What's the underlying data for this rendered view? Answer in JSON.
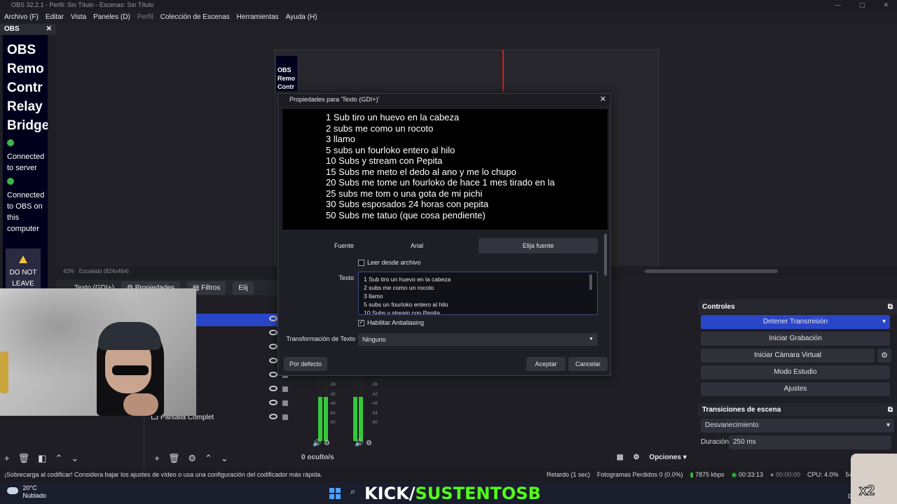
{
  "window": {
    "title": "OBS 32.2.1 - Perfil: Sin Título - Escenas: Sin Título"
  },
  "menu": [
    {
      "label": "Archivo (F)",
      "dim": false
    },
    {
      "label": "Editar",
      "dim": false
    },
    {
      "label": "Vista",
      "dim": false
    },
    {
      "label": "Paneles (D)",
      "dim": false
    },
    {
      "label": "Perfil",
      "dim": true
    },
    {
      "label": "Colección de Escenas",
      "dim": false
    },
    {
      "label": "Herramientas",
      "dim": false
    },
    {
      "label": "Ayuda (H)",
      "dim": false
    }
  ],
  "plugin_dock": {
    "title": "OBS",
    "heading_lines": [
      "OBS",
      "Remo",
      "Contr",
      "Relay",
      "Bridge"
    ],
    "status1": "Connected to server",
    "status2": "Connected to OBS on this computer",
    "warning": "DO NOT LEAVE"
  },
  "mini_obs": "OBS Remo Contr",
  "zoom": {
    "level": "42%",
    "scale": "Escalado (824x464)"
  },
  "source_toolbar": {
    "source_name": "Texto (GDI+)",
    "properties": "Propiedades",
    "filters": "Filtros",
    "more": "Elij"
  },
  "dialog": {
    "title": "Propiedades para 'Texto (GDI+)'",
    "preview_text": "1 Sub tiro un huevo en la cabeza\n2 subs me como un rocoto\n3 llamo\n5 subs un fourloko entero al hilo\n10 Subs y stream con Pepita\n15 Subs me meto el dedo al ano y me lo chupo\n20 Subs me tome un fourloko de hace 1 mes tirado en la\n25 subs me tom o una gota de mi pichi\n30 Subs esposados 24 horas con pepita\n50 Subs me tatuo (que cosa pendiente)",
    "font_label": "Fuente",
    "font_value": "Arial",
    "font_button": "Elija fuente",
    "read_from_file": "Leer desde archivo",
    "text_label": "Texto",
    "text_value": "1 Sub tiro un huevo en la cabeza\n2 subs me como un rocoto\n3 llamo\n5 subs un fourloko entero al hilo\n10 Subs y stream con Pepita",
    "antialias": "Habilitar Antialiasing",
    "transform_label": "Transformación de Texto",
    "transform_value": "Ninguno",
    "defaults_button": "Por defecto",
    "accept_button": "Aceptar",
    "cancel_button": "Cancelar"
  },
  "sources": {
    "bottom_label": "Pantalla Complet"
  },
  "mixer": {
    "status": "0 oculto/s",
    "options": "Opciones",
    "ticks": [
      "-36",
      "-42",
      "-48",
      "-54",
      "-60"
    ]
  },
  "controls": {
    "title": "Controles",
    "stop_stream": "Detener Transmisión",
    "start_recording": "Iniciar Grabación",
    "start_virtual_cam": "Iniciar Cámara Virtual",
    "studio_mode": "Modo Estudio",
    "settings": "Ajustes"
  },
  "transitions": {
    "title": "Transiciones de escena",
    "selected": "Desvanecimiento",
    "duration_label": "Duración",
    "duration_value": "250 ms"
  },
  "statusbar": {
    "message": "¡Sobrecarga al codificar! Considera bajar los ajustes de vídeo o usa una configuración del codificador más rápida.",
    "delay": "Retardo (1 sec)",
    "dropped": "Fotogramas Perdidos 0 (0.0%)",
    "bitrate": "7875 kbps",
    "stream_time": "00:33:13",
    "rec_time": "00:00:00",
    "cpu": "CPU: 4.0%",
    "fps": "54"
  },
  "taskbar": {
    "temp": "20°C",
    "weather": "Nublado",
    "overlay_white": "KICK/",
    "overlay_brand": "SUSTENTOSB",
    "date": "07/0"
  },
  "overlay_badge": "x2",
  "colors": {
    "accent": "#2a46c8",
    "kick_green": "#53fc18",
    "meter_green": "#35c83a"
  }
}
